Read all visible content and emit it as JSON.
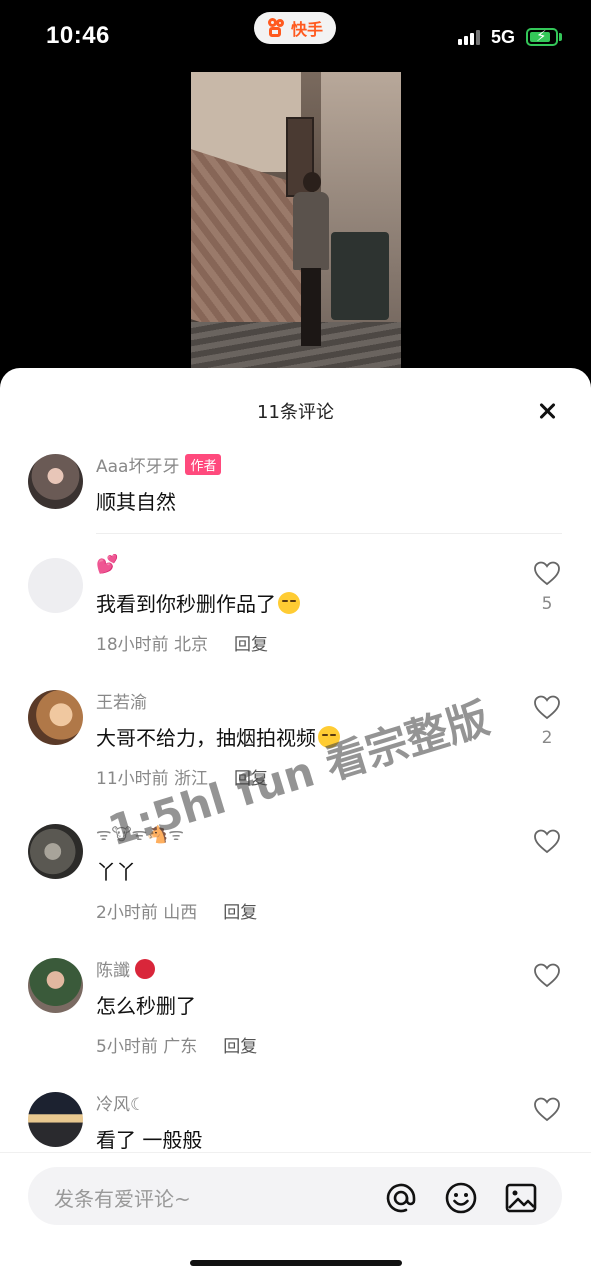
{
  "status_bar": {
    "time": "10:46",
    "app_name": "快手",
    "network": "5G"
  },
  "sheet": {
    "title": "11条评论"
  },
  "comments": [
    {
      "author": "Aaa坏牙牙",
      "badge": "作者",
      "text": "顺其自然"
    },
    {
      "author": "💕",
      "text": "我看到你秒删作品了",
      "time": "18小时前",
      "location": "北京",
      "reply": "回复",
      "likes": "5"
    },
    {
      "author": "王若渝",
      "text": "大哥不给力，抽烟拍视频",
      "time": "11小时前",
      "location": "浙江",
      "reply": "回复",
      "likes": "2"
    },
    {
      "author": "ᯤ🐮ᯤ🐴ᯤ",
      "text": "丫丫",
      "time": "2小时前",
      "location": "山西",
      "reply": "回复"
    },
    {
      "author": "陈讖",
      "text": "怎么秒删了",
      "time": "5小时前",
      "location": "广东",
      "reply": "回复"
    },
    {
      "author": "冷风☾",
      "text": "看了 一般般"
    }
  ],
  "watermark": "1:5hl fun 看宗整版",
  "input": {
    "placeholder": "发条有爱评论~"
  },
  "icons": [
    "close-icon",
    "heart-icon",
    "at-icon",
    "emoji-icon",
    "image-icon"
  ],
  "colors": {
    "accent": "#ff5a1f",
    "author_badge": "#ff4a7d",
    "battery": "#34c759"
  }
}
